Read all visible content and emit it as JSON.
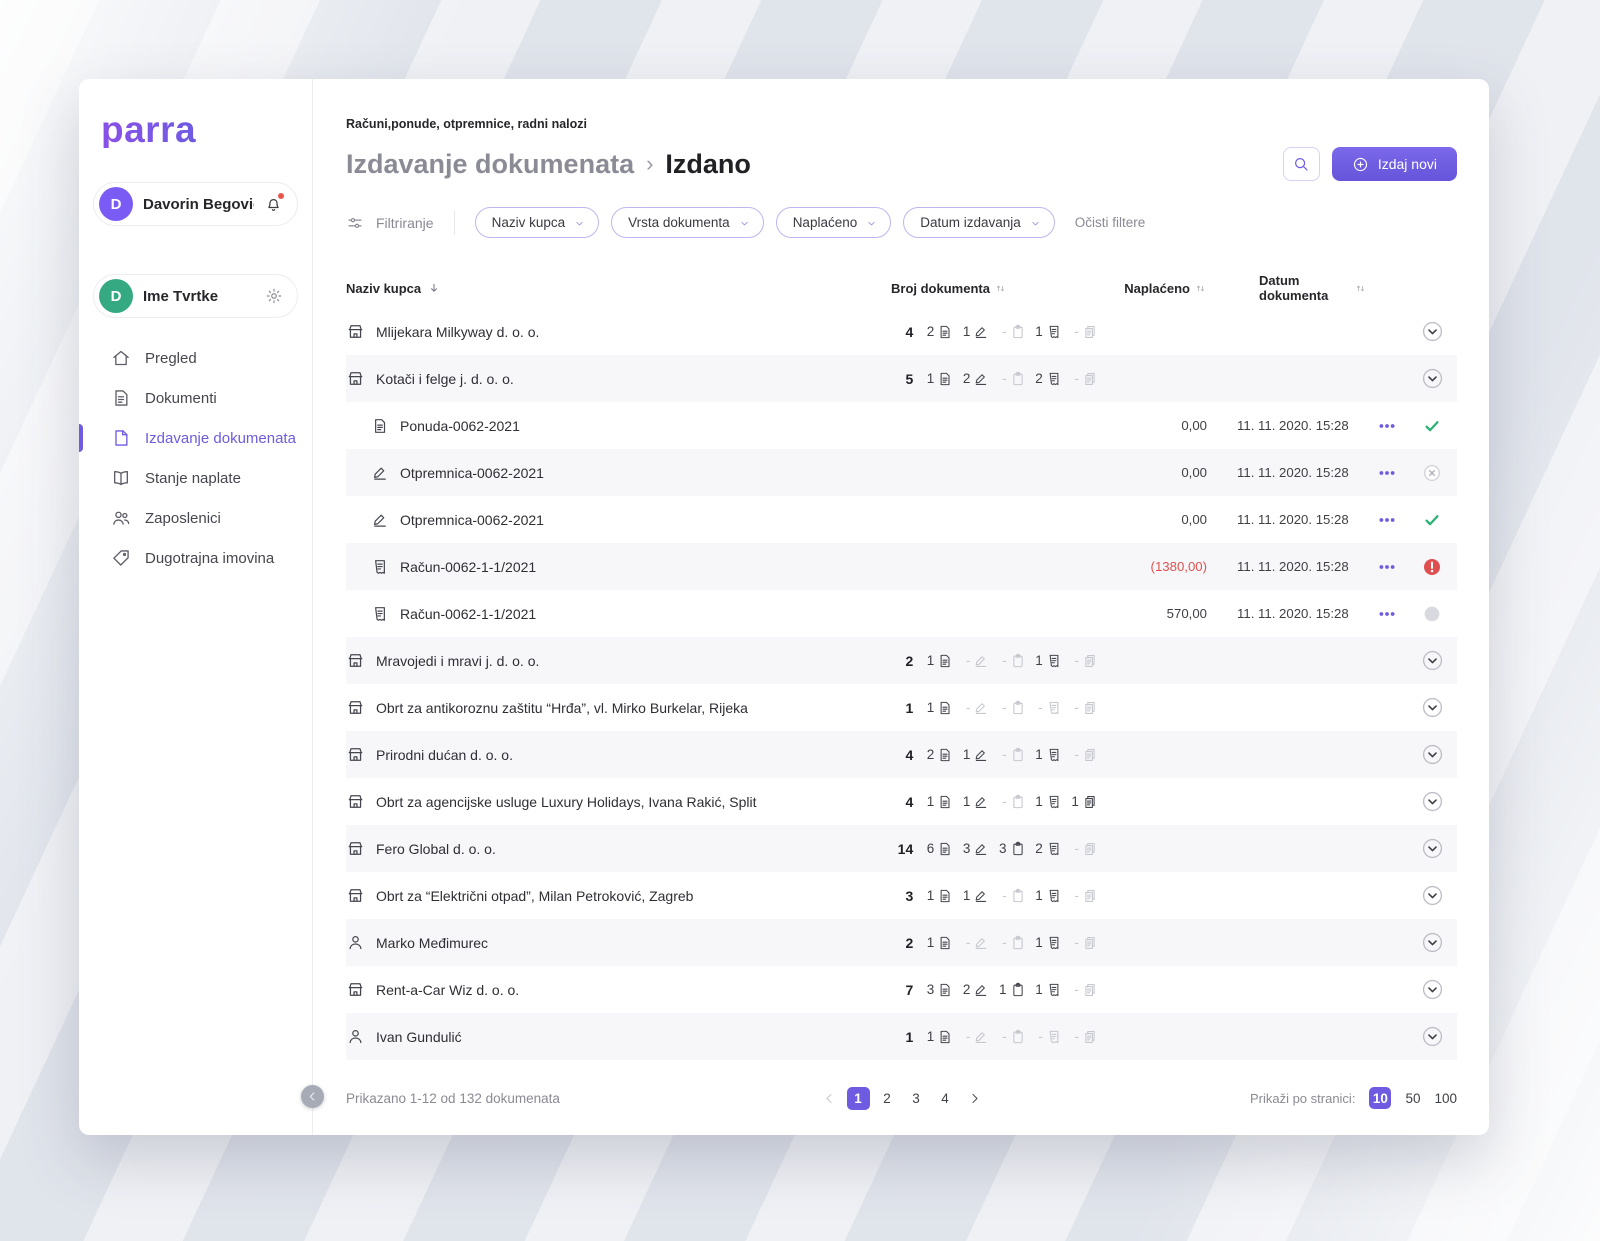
{
  "colors": {
    "accent": "#6e5be2",
    "success": "#29b274",
    "error": "#e04f4f",
    "muted": "#c7c7d0",
    "avatar_user": "#7a5cf5",
    "avatar_company": "#35a982"
  },
  "sidebar": {
    "logo": "parra",
    "user": {
      "initial": "D",
      "name": "Davorin Begović"
    },
    "company": {
      "initial": "D",
      "name": "Ime Tvrtke"
    },
    "items": [
      {
        "label": "Pregled",
        "icon": "home",
        "active": false
      },
      {
        "label": "Dokumenti",
        "icon": "doc",
        "active": false
      },
      {
        "label": "Izdavanje dokumenata",
        "icon": "file",
        "active": true
      },
      {
        "label": "Stanje naplate",
        "icon": "book",
        "active": false
      },
      {
        "label": "Zaposlenici",
        "icon": "people",
        "active": false
      },
      {
        "label": "Dugotrajna imovina",
        "icon": "tag",
        "active": false
      }
    ]
  },
  "header": {
    "eyebrow": "Računi,ponude, otpremnice, radni nalozi",
    "breadcrumb_parent": "Izdavanje dokumenata",
    "breadcrumb_sep": "›",
    "breadcrumb_current": "Izdano",
    "new_button": "Izdaj novi"
  },
  "filters": {
    "label": "Filtriranje",
    "pills": [
      "Naziv kupca",
      "Vrsta dokumenta",
      "Naplaćeno",
      "Datum izdavanja"
    ],
    "clear": "Očisti filtere"
  },
  "table": {
    "columns": [
      "Naziv kupca",
      "Broj dokumenta",
      "Naplaćeno",
      "Datum dokumenta"
    ],
    "doc_type_icons": [
      "page",
      "pen",
      "clipboard",
      "invoice",
      "copies"
    ],
    "rows": [
      {
        "type": "customer",
        "icon": "company",
        "name": "Mlijekara Milkyway d. o. o.",
        "total": "4",
        "counts": [
          "2",
          "1",
          "-",
          "1",
          "-"
        ]
      },
      {
        "type": "customer",
        "icon": "company",
        "name": "Kotači i felge j. d. o. o.",
        "total": "5",
        "counts": [
          "1",
          "2",
          "-",
          "2",
          "-"
        ],
        "expanded": true
      },
      {
        "type": "doc",
        "icon": "page",
        "name": "Ponuda-0062-2021",
        "amount": "0,00",
        "date": "11. 11. 2020. 15:28",
        "status": "success"
      },
      {
        "type": "doc",
        "icon": "pen",
        "name": "Otpremnica-0062-2021",
        "amount": "0,00",
        "date": "11. 11. 2020. 15:28",
        "status": "canceled"
      },
      {
        "type": "doc",
        "icon": "pen",
        "name": "Otpremnica-0062-2021",
        "amount": "0,00",
        "date": "11. 11. 2020. 15:28",
        "status": "success"
      },
      {
        "type": "doc",
        "icon": "invoice",
        "name": "Račun-0062-1-1/2021",
        "amount": "(1380,00)",
        "negative": true,
        "date": "11. 11. 2020. 15:28",
        "status": "error"
      },
      {
        "type": "doc",
        "icon": "invoice",
        "name": "Račun-0062-1-1/2021",
        "amount": "570,00",
        "date": "11. 11. 2020. 15:28",
        "status": "none"
      },
      {
        "type": "customer",
        "icon": "company",
        "name": "Mravojedi i mravi j. d. o. o.",
        "total": "2",
        "counts": [
          "1",
          "-",
          "-",
          "1",
          "-"
        ]
      },
      {
        "type": "customer",
        "icon": "company",
        "name": "Obrt za antikoroznu zaštitu “Hrđa”, vl. Mirko Burkelar, Rijeka",
        "total": "1",
        "counts": [
          "1",
          "-",
          "-",
          "-",
          "-"
        ]
      },
      {
        "type": "customer",
        "icon": "company",
        "name": "Prirodni dućan d. o. o.",
        "total": "4",
        "counts": [
          "2",
          "1",
          "-",
          "1",
          "-"
        ]
      },
      {
        "type": "customer",
        "icon": "company",
        "name": "Obrt za agencijske usluge Luxury Holidays, Ivana Rakić, Split",
        "total": "4",
        "counts": [
          "1",
          "1",
          "-",
          "1",
          "1"
        ]
      },
      {
        "type": "customer",
        "icon": "company",
        "name": "Fero Global d. o. o.",
        "total": "14",
        "counts": [
          "6",
          "3",
          "3",
          "2",
          "-"
        ]
      },
      {
        "type": "customer",
        "icon": "company",
        "name": "Obrt za “Električni otpad”, Milan Petroković, Zagreb",
        "total": "3",
        "counts": [
          "1",
          "1",
          "-",
          "1",
          "-"
        ]
      },
      {
        "type": "customer",
        "icon": "person",
        "name": "Marko Međimurec",
        "total": "2",
        "counts": [
          "1",
          "-",
          "-",
          "1",
          "-"
        ]
      },
      {
        "type": "customer",
        "icon": "company",
        "name": "Rent-a-Car Wiz d. o. o.",
        "total": "7",
        "counts": [
          "3",
          "2",
          "1",
          "1",
          "-"
        ]
      },
      {
        "type": "customer",
        "icon": "person",
        "name": "Ivan Gundulić",
        "total": "1",
        "counts": [
          "1",
          "-",
          "-",
          "-",
          "-"
        ]
      }
    ]
  },
  "footer": {
    "summary": "Prikazano 1-12 od 132 dokumenata",
    "pages": [
      "1",
      "2",
      "3",
      "4"
    ],
    "active_page": "1",
    "per_page_label": "Prikaži po stranici:",
    "per_page_options": [
      "10",
      "50",
      "100"
    ],
    "active_per_page": "10"
  }
}
